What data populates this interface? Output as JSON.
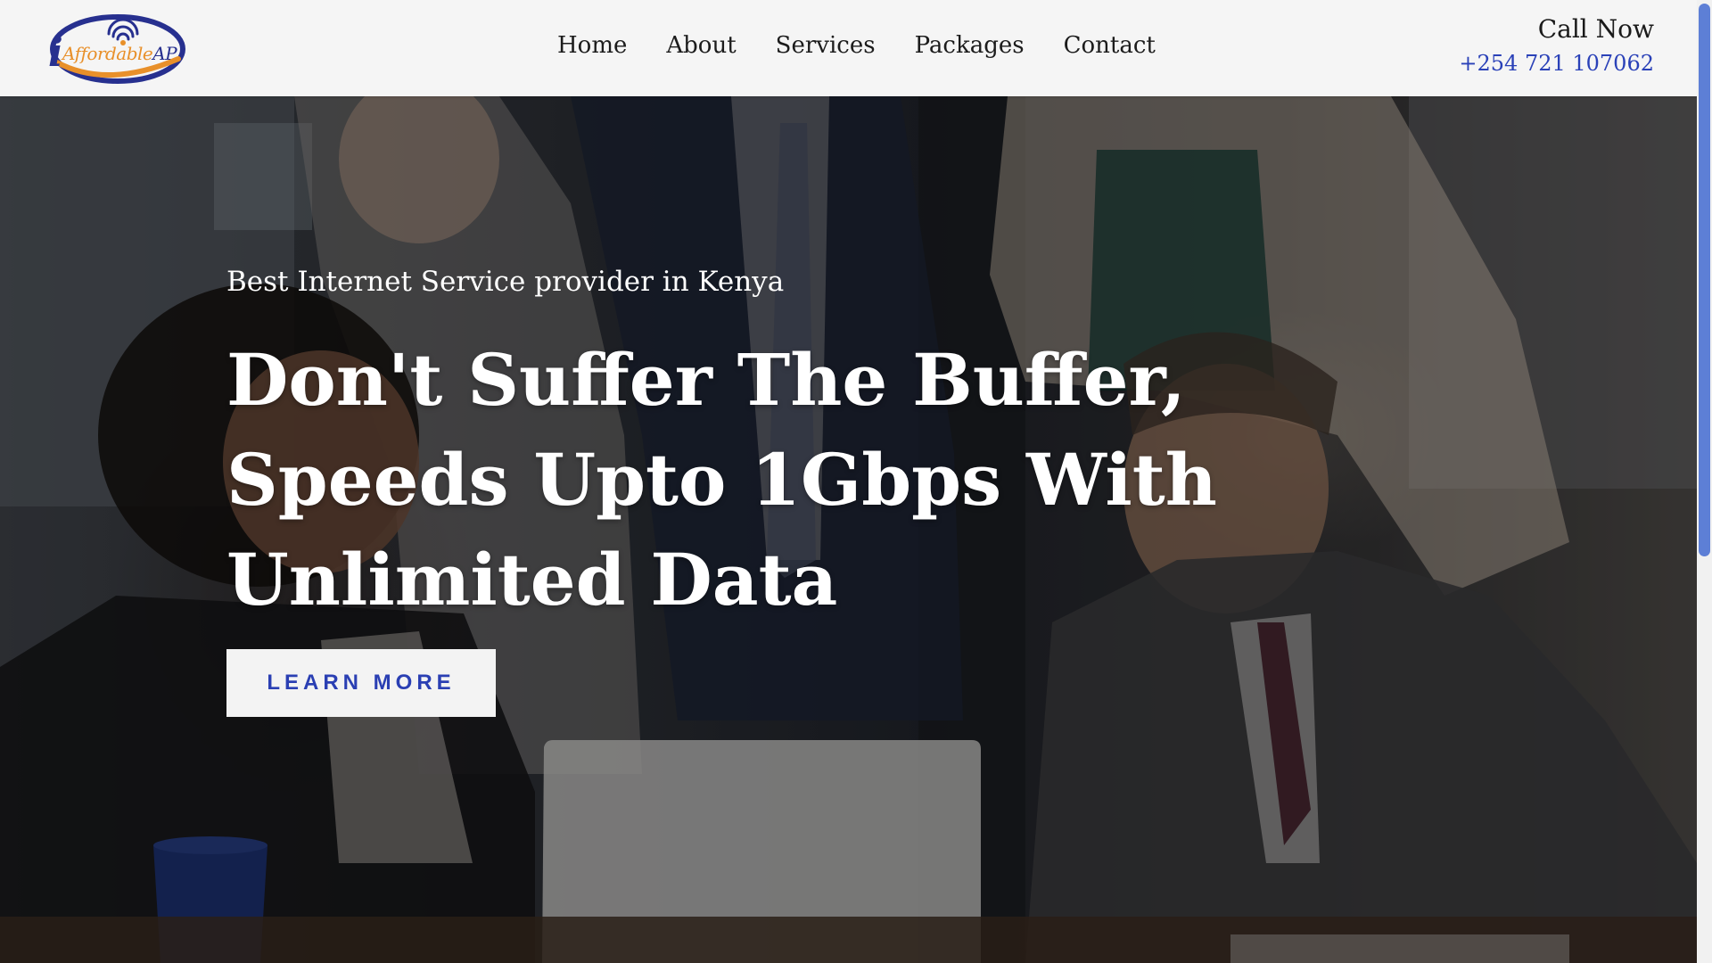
{
  "header": {
    "logo": {
      "letter": "i",
      "word": "Affordable",
      "suffix": "AP"
    },
    "nav": [
      {
        "label": "Home"
      },
      {
        "label": "About"
      },
      {
        "label": "Services"
      },
      {
        "label": "Packages"
      },
      {
        "label": "Contact"
      }
    ],
    "call": {
      "label": "Call Now",
      "phone": "+254 721 107062"
    }
  },
  "hero": {
    "tagline": "Best Internet Service provider in Kenya",
    "headline": [
      "Don't Suffer The Buffer,",
      "Speeds Upto 1Gbps With",
      "Unlimited Data"
    ],
    "cta_label": "LEARN MORE"
  },
  "colors": {
    "brand_blue": "#27308f",
    "brand_orange": "#e8902a",
    "link_blue": "#2a41b8",
    "header_bg": "#f5f5f5",
    "scroll_thumb": "#5d7fd6"
  },
  "icons": {
    "logo_signal": "wifi-signal-icon"
  }
}
